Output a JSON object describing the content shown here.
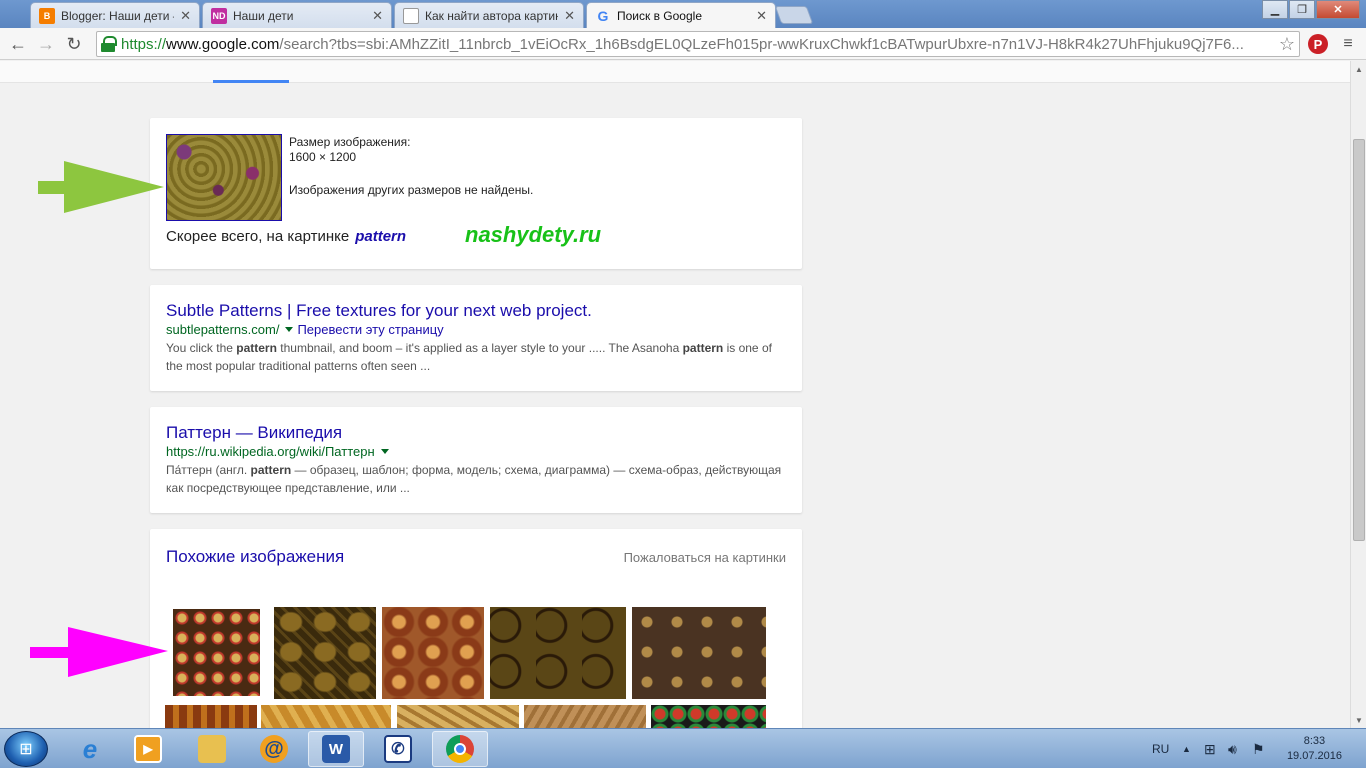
{
  "browser": {
    "tabs": [
      {
        "title": "Blogger: Наши дети – Всё",
        "favicon_color": "#f57d00"
      },
      {
        "title": "Наши дети",
        "favicon_color": "#c02fa0"
      },
      {
        "title": "Как найти автора картинк",
        "favicon_color": "#ffffff"
      },
      {
        "title": "Поиск в Google",
        "favicon_color": "#4285f4"
      }
    ],
    "url_https": "https://",
    "url_host": "www.google.com",
    "url_rest": "/search?tbs=sbi:AMhZZitI_11nbrcb_1vEiOcRx_1h6BsdgEL0QLzeFh015pr-wwKruxChwkf1cBATwpurUbxre-n7n1VJ-H8kR4k27UhFhjuku9Qj7F6..."
  },
  "image_info": {
    "size_label": "Размер изображения:",
    "size_value": "1600 × 1200",
    "no_other_sizes": "Изображения других размеров не найдены.",
    "best_guess_label": "Скорее всего, на картинке",
    "best_guess_value": "pattern",
    "watermark": "nashydety.ru"
  },
  "results": [
    {
      "title": "Subtle Patterns | Free textures for your next web project.",
      "url": "subtlepatterns.com/",
      "translate": "Перевести эту страницу",
      "snippet_parts": [
        "You click the ",
        "pattern",
        " thumbnail, and boom – it's applied as a layer style to your ..... The Asanoha ",
        "pattern",
        " is one of the most popular traditional patterns often seen ..."
      ]
    },
    {
      "title": "Паттерн — Википедия",
      "url": "https://ru.wikipedia.org/wiki/Паттерн",
      "snippet_parts": [
        "Па́ттерн (англ. ",
        "pattern",
        " — образец, шаблон; форма, модель; схема, диаграмма) — схема-образ, действующая как посредствующее представление, или ..."
      ]
    }
  ],
  "similar": {
    "title": "Похожие изображения",
    "report": "Пожаловаться на картинки"
  },
  "taskbar": {
    "lang": "RU",
    "time": "8:33",
    "date": "19.07.2016"
  },
  "colors": {
    "link": "#1a0dab",
    "url_green": "#006621",
    "watermark_green": "#18c118",
    "arrow_green": "#8dc63f",
    "arrow_magenta": "#ff00ff"
  }
}
